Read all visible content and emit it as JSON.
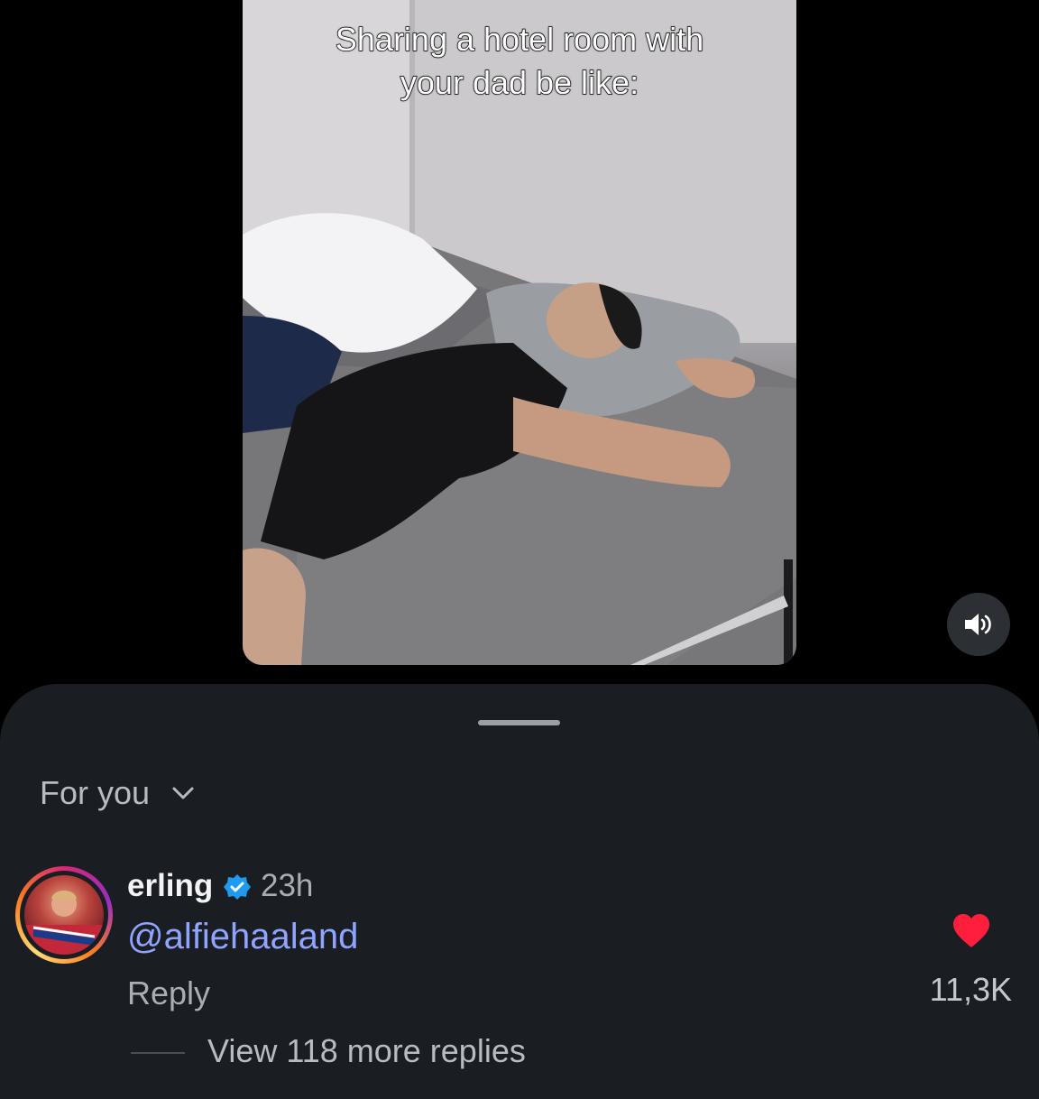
{
  "video": {
    "caption_line1": "Sharing a hotel room with",
    "caption_line2": "your dad be like:"
  },
  "sound_button": {
    "icon": "speaker-on-icon"
  },
  "comments_sheet": {
    "filter_label": "For you",
    "filter_icon": "chevron-down-icon",
    "comment": {
      "username": "erling",
      "verified": true,
      "time": "23h",
      "text": "@alfiehaaland",
      "reply_label": "Reply",
      "like_count": "11,3K",
      "liked": true,
      "view_replies_label": "View 118 more replies"
    }
  },
  "colors": {
    "sheet_bg": "#1a1d21",
    "mention": "#8fa4ff",
    "heart": "#ff1f3d",
    "verified": "#1d9bf0"
  }
}
